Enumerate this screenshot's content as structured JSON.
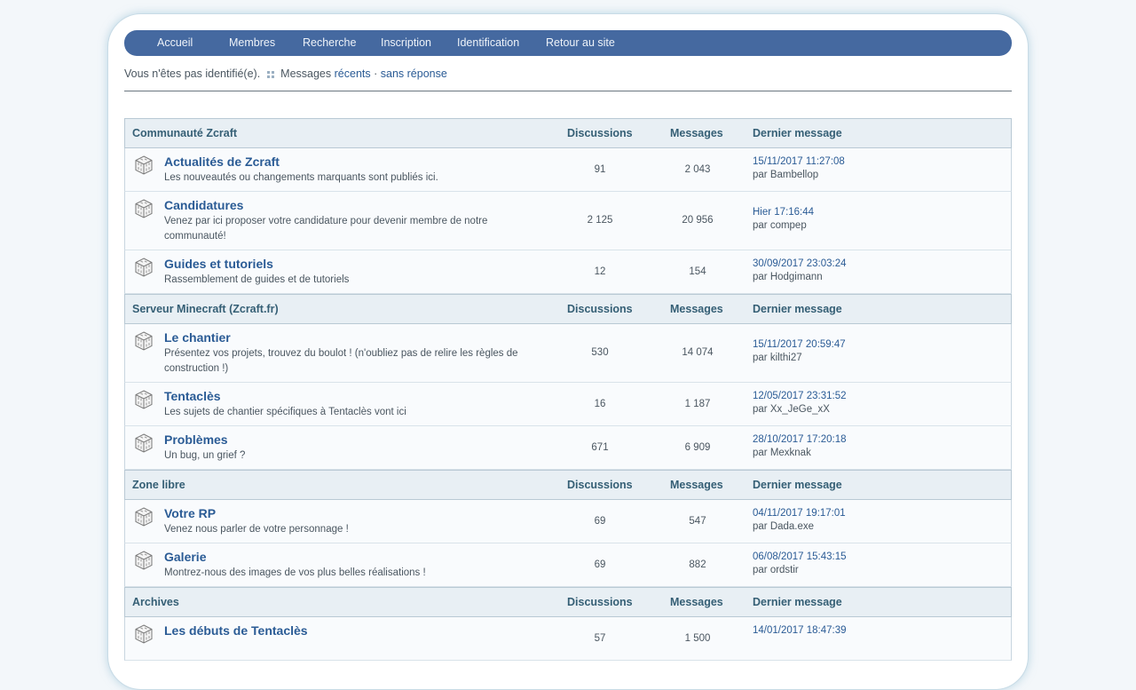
{
  "nav": [
    {
      "label": "Accueil"
    },
    {
      "label": "Membres"
    },
    {
      "label": "Recherche"
    },
    {
      "label": "Inscription"
    },
    {
      "label": "Identification"
    },
    {
      "label": "Retour au site"
    }
  ],
  "status": {
    "not_logged": "Vous n'êtes pas identifié(e).",
    "messages_label": "Messages",
    "recent_link": "récents",
    "separator": "·",
    "unanswered_link": "sans réponse"
  },
  "column_headers": {
    "discussions": "Discussions",
    "messages": "Messages",
    "last_post": "Dernier message"
  },
  "categories": [
    {
      "name": "Communauté Zcraft",
      "forums": [
        {
          "title": "Actualités de Zcraft",
          "desc": "Les nouveautés ou changements marquants sont publiés ici.",
          "discussions": "91",
          "messages": "2 043",
          "last_date": "15/11/2017 11:27:08",
          "last_by": "par Bambellop"
        },
        {
          "title": "Candidatures",
          "desc": "Venez par ici proposer votre candidature pour devenir membre de notre communauté!",
          "discussions": "2 125",
          "messages": "20 956",
          "last_date": "Hier 17:16:44",
          "last_by": "par compep"
        },
        {
          "title": "Guides et tutoriels",
          "desc": "Rassemblement de guides et de tutoriels",
          "discussions": "12",
          "messages": "154",
          "last_date": "30/09/2017 23:03:24",
          "last_by": "par Hodgimann"
        }
      ]
    },
    {
      "name": "Serveur Minecraft (Zcraft.fr)",
      "forums": [
        {
          "title": "Le chantier",
          "desc": "Présentez vos projets, trouvez du boulot ! (n'oubliez pas de relire les règles de construction !)",
          "discussions": "530",
          "messages": "14 074",
          "last_date": "15/11/2017 20:59:47",
          "last_by": "par kilthi27"
        },
        {
          "title": "Tentaclès",
          "desc": "Les sujets de chantier spécifiques à Tentaclès vont ici",
          "discussions": "16",
          "messages": "1 187",
          "last_date": "12/05/2017 23:31:52",
          "last_by": "par Xx_JeGe_xX"
        },
        {
          "title": "Problèmes",
          "desc": "Un bug, un grief ?",
          "discussions": "671",
          "messages": "6 909",
          "last_date": "28/10/2017 17:20:18",
          "last_by": "par Mexknak"
        }
      ]
    },
    {
      "name": "Zone libre",
      "forums": [
        {
          "title": "Votre RP",
          "desc": "Venez nous parler de votre personnage !",
          "discussions": "69",
          "messages": "547",
          "last_date": "04/11/2017 19:17:01",
          "last_by": "par Dada.exe"
        },
        {
          "title": "Galerie",
          "desc": "Montrez-nous des images de vos plus belles réalisations !",
          "discussions": "69",
          "messages": "882",
          "last_date": "06/08/2017 15:43:15",
          "last_by": "par ordstir"
        }
      ]
    },
    {
      "name": "Archives",
      "forums": [
        {
          "title": "Les débuts de Tentaclès",
          "desc": "",
          "discussions": "57",
          "messages": "1 500",
          "last_date": "14/01/2017 18:47:39",
          "last_by": ""
        }
      ]
    }
  ],
  "icons": {
    "forum": "forum-cube-icon",
    "bullet": "grid-dots-icon"
  },
  "colors": {
    "navbar": "#4569a0",
    "link": "#2a5b95",
    "header_bg": "#e8eff4",
    "header_text": "#355f75"
  }
}
